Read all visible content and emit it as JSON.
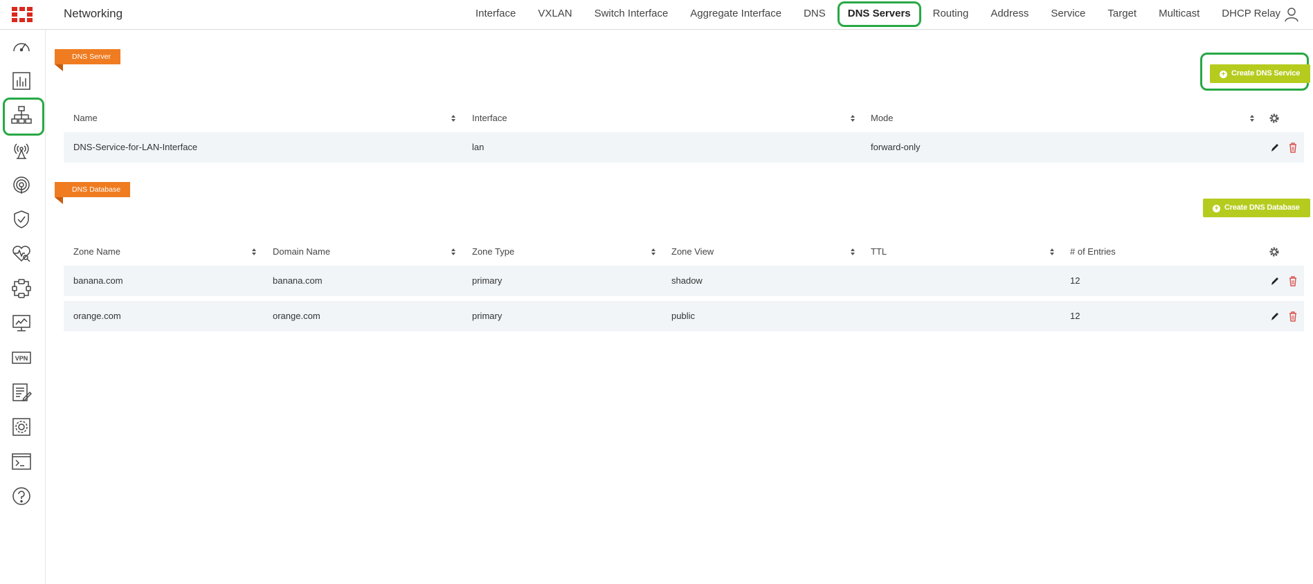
{
  "header": {
    "app_title": "Networking",
    "tabs": [
      "Interface",
      "VXLAN",
      "Switch Interface",
      "Aggregate Interface",
      "DNS",
      "DNS Servers",
      "Routing",
      "Address",
      "Service",
      "Target",
      "Multicast",
      "DHCP Relay"
    ],
    "active_tab": "DNS Servers"
  },
  "sidebar": {
    "items": [
      "dashboard-icon",
      "chart-icon",
      "network-icon",
      "wireless-icon",
      "signal-icon",
      "security-shield-icon",
      "health-check-icon",
      "sdwan-icon",
      "monitor-icon",
      "vpn-icon",
      "log-report-icon",
      "system-settings-icon",
      "cli-console-icon",
      "help-icon"
    ],
    "vpn_label": "VPN",
    "active": "network-icon"
  },
  "dns_server": {
    "tag": "DNS Server",
    "create_button": "Create DNS Service",
    "columns": [
      "Name",
      "Interface",
      "Mode"
    ],
    "rows": [
      {
        "name": "DNS-Service-for-LAN-Interface",
        "interface": "lan",
        "mode": "forward-only"
      }
    ]
  },
  "dns_database": {
    "tag": "DNS Database",
    "create_button": "Create DNS Database",
    "columns": [
      "Zone Name",
      "Domain Name",
      "Zone Type",
      "Zone View",
      "TTL",
      "# of Entries"
    ],
    "rows": [
      {
        "zone_name": "banana.com",
        "domain_name": "banana.com",
        "zone_type": "primary",
        "zone_view": "shadow",
        "ttl": "",
        "entries": "12"
      },
      {
        "zone_name": "orange.com",
        "domain_name": "orange.com",
        "zone_type": "primary",
        "zone_view": "public",
        "ttl": "",
        "entries": "12"
      }
    ]
  },
  "colors": {
    "accent_orange": "#ef7c21",
    "button_green": "#b5cc1f",
    "highlight_green": "#27a844",
    "delete_red": "#d9534f"
  }
}
